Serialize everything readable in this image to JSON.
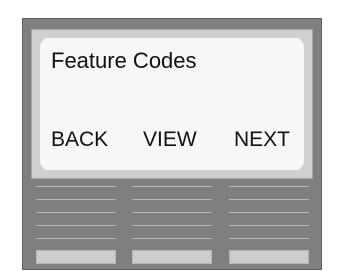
{
  "display": {
    "title": "Feature Codes",
    "softkeys": {
      "back": "BACK",
      "view": "VIEW",
      "next": "NEXT"
    }
  },
  "colors": {
    "device_body": "#7f7f7f",
    "screen_bezel": "#d0d0d0",
    "screen_background": "#f7f7f7",
    "key": "#cdcdcd"
  }
}
